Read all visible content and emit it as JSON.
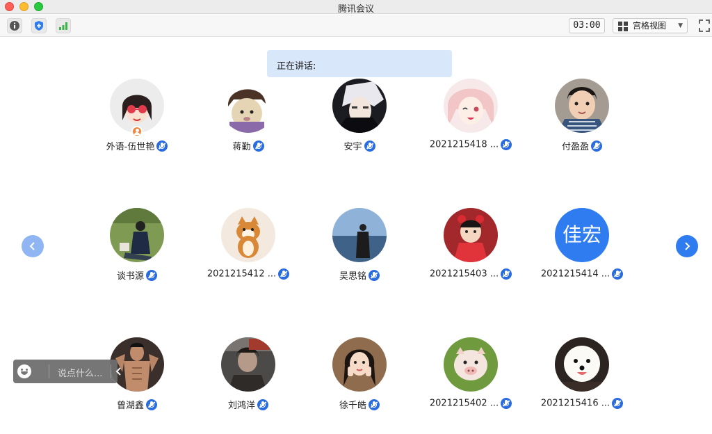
{
  "window": {
    "title": "腾讯会议"
  },
  "toolbar": {
    "timer": "03:00",
    "view_label": "宫格视图",
    "icons": [
      "info-icon",
      "security-shield-icon",
      "signal-icon",
      "grid-view-icon",
      "chevron-down-icon",
      "fullscreen-icon"
    ]
  },
  "speaking_label": "正在讲话:",
  "colors": {
    "accent": "#2f7bf0",
    "speaking_bg": "#d9e7fa",
    "host_badge": "#f0853b"
  },
  "participants": [
    {
      "name": "外语-伍世艳",
      "host": true
    },
    {
      "name": "蒋勤"
    },
    {
      "name": "安宇"
    },
    {
      "name": "2021215418 ..."
    },
    {
      "name": "付盈盈"
    },
    {
      "name": "谈书源"
    },
    {
      "name": "2021215412 ..."
    },
    {
      "name": "吴思铭"
    },
    {
      "name": "2021215403 ..."
    },
    {
      "name": "2021215414 ...",
      "avatar_text": "佳宏"
    },
    {
      "name": "曾湖鑫"
    },
    {
      "name": "刘鸿洋"
    },
    {
      "name": "徐千皓"
    },
    {
      "name": "2021215402 ..."
    },
    {
      "name": "2021215416 ..."
    }
  ],
  "chat": {
    "placeholder": "说点什么..."
  }
}
